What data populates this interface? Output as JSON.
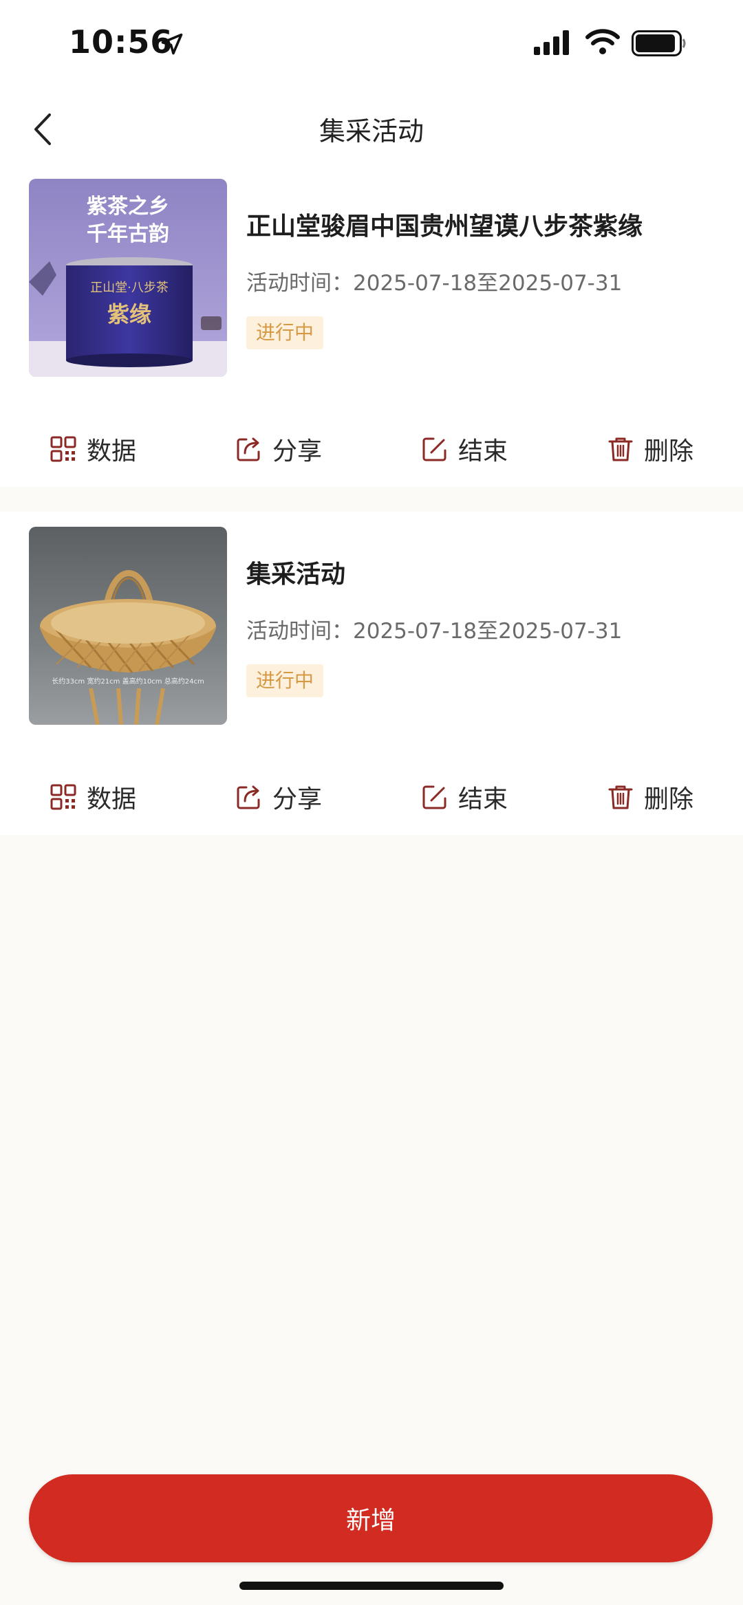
{
  "status_bar": {
    "time": "10:56",
    "icons": [
      "location-arrow-icon",
      "cellular-signal-icon",
      "wifi-icon",
      "battery-icon"
    ]
  },
  "nav": {
    "title": "集采活动",
    "back_icon": "chevron-left-icon"
  },
  "activities": [
    {
      "title": "正山堂骏眉中国贵州望谟八步茶紫缘",
      "date_label": "活动时间：",
      "date_range": "2025-07-18至2025-07-31",
      "status": "进行中",
      "image": {
        "desc_icon": "tea-tin-image",
        "headline_line1": "紫茶之乡",
        "headline_line2": "千年古韵",
        "tin_brand": "正山堂·八步茶",
        "tin_name": "紫缘"
      }
    },
    {
      "title": "集采活动",
      "date_label": "活动时间：",
      "date_range": "2025-07-18至2025-07-31",
      "status": "进行中",
      "image": {
        "desc_icon": "bamboo-basket-image",
        "caption": "长约33cm  宽约21cm  盖高约10cm  总高约24cm"
      }
    }
  ],
  "actions": [
    {
      "label": "数据",
      "icon": "grid-data-icon"
    },
    {
      "label": "分享",
      "icon": "share-icon"
    },
    {
      "label": "结束",
      "icon": "edit-icon"
    },
    {
      "label": "删除",
      "icon": "trash-icon"
    }
  ],
  "footer": {
    "add_label": "新增"
  },
  "colors": {
    "primary": "#d22b22",
    "badge_bg": "#fdf0dc",
    "badge_text": "#d69a45",
    "icon_stroke": "#8b2a24",
    "page_bg": "#fbfaf6"
  }
}
